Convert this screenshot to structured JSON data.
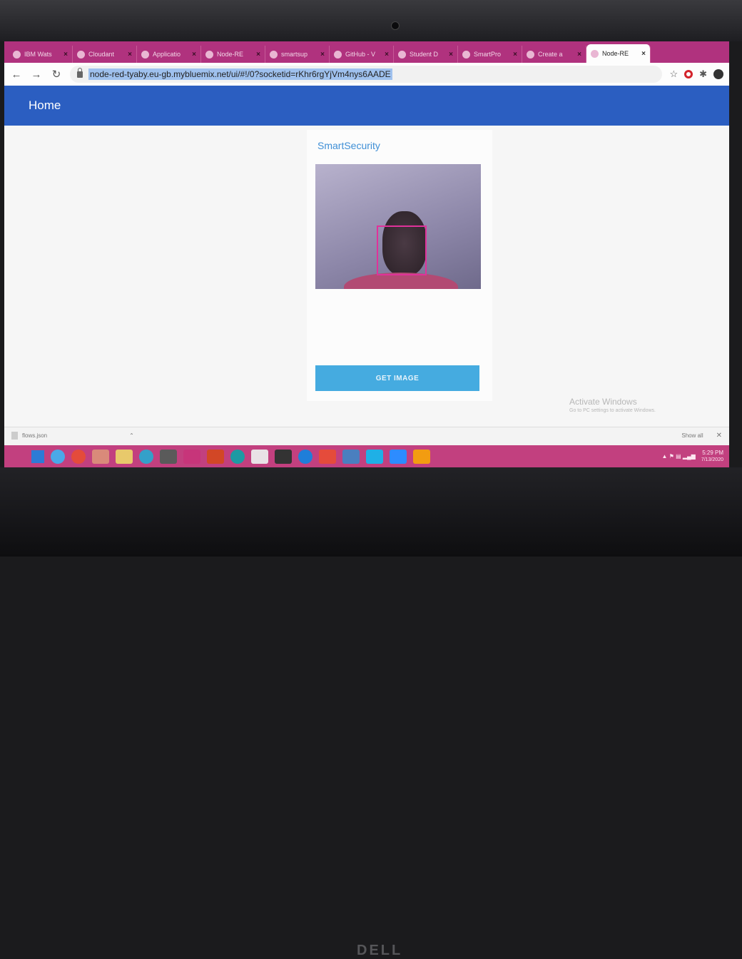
{
  "browser": {
    "tabs": [
      {
        "label": "IBM Wats",
        "active": false
      },
      {
        "label": "Cloudant",
        "active": false
      },
      {
        "label": "Applicatio",
        "active": false
      },
      {
        "label": "Node-RE",
        "active": false
      },
      {
        "label": "smartsup",
        "active": false
      },
      {
        "label": "GitHub - V",
        "active": false
      },
      {
        "label": "Student D",
        "active": false
      },
      {
        "label": "SmartPro",
        "active": false
      },
      {
        "label": "Create a",
        "active": false
      },
      {
        "label": "Node-RE",
        "active": true
      }
    ],
    "close_glyph": "×",
    "url": "node-red-tyaby.eu-gb.mybluemix.net/ui/#!/0?socketid=rKhr6rgYjVm4nys6AADE"
  },
  "dashboard": {
    "header_title": "Home",
    "group_title": "SmartSecurity",
    "button_label": "GET IMAGE"
  },
  "watermark": {
    "title": "Activate Windows",
    "subtitle": "Go to PC settings to activate Windows."
  },
  "download_bar": {
    "filename": "flows.json",
    "show_all": "Show all"
  },
  "taskbar": {
    "time": "5:29 PM",
    "date": "7/13/2020",
    "brand_color": "#c2407f"
  },
  "hardware": {
    "logo": "DELL"
  }
}
